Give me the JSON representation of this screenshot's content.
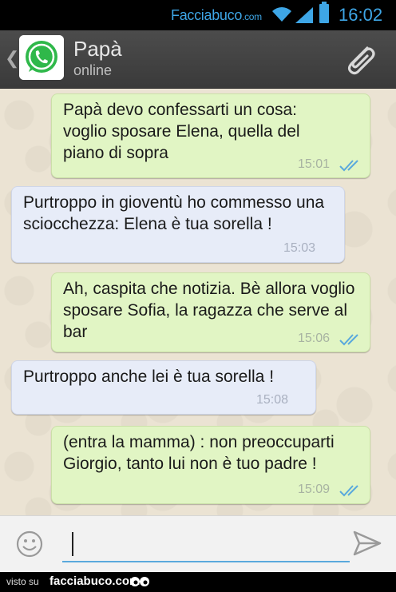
{
  "status_bar": {
    "brand": "Facciabuco",
    "brand_suffix": ".com",
    "time": "16:02",
    "icons": [
      "wifi-icon",
      "signal-icon",
      "battery-icon"
    ],
    "accent_color": "#3ea6e6"
  },
  "header": {
    "contact_name": "Papà",
    "contact_status": "online",
    "icons": [
      "back-chevron-icon",
      "whatsapp-avatar-icon",
      "paperclip-icon"
    ]
  },
  "messages": [
    {
      "direction": "outgoing",
      "text": "Papà devo confessarti un cosa: voglio sposare Elena, quella del piano di sopra",
      "time": "15:01",
      "read": true
    },
    {
      "direction": "incoming",
      "text": "Purtroppo in gioventù ho commesso una sciocchezza: Elena è tua sorella !",
      "time": "15:03"
    },
    {
      "direction": "outgoing",
      "text": "Ah, caspita che notizia. Bè allora voglio sposare Sofia, la ragazza che serve al bar",
      "time": "15:06",
      "read": true
    },
    {
      "direction": "incoming",
      "text": "Purtroppo anche lei è tua sorella !",
      "time": "15:08"
    },
    {
      "direction": "outgoing",
      "text": "(entra la mamma) : non preoccuparti Giorgio, tanto lui non è tuo padre !",
      "time": "15:09",
      "read": true
    }
  ],
  "input_bar": {
    "message_value": "",
    "icons": [
      "emoji-icon",
      "send-icon"
    ]
  },
  "footer": {
    "visto": "visto su",
    "brand": "facciabuco.com"
  },
  "colors": {
    "outgoing_bubble": "#e1f5c4",
    "incoming_bubble": "#e7ecf8",
    "read_ticks": "#5aa9dc"
  }
}
